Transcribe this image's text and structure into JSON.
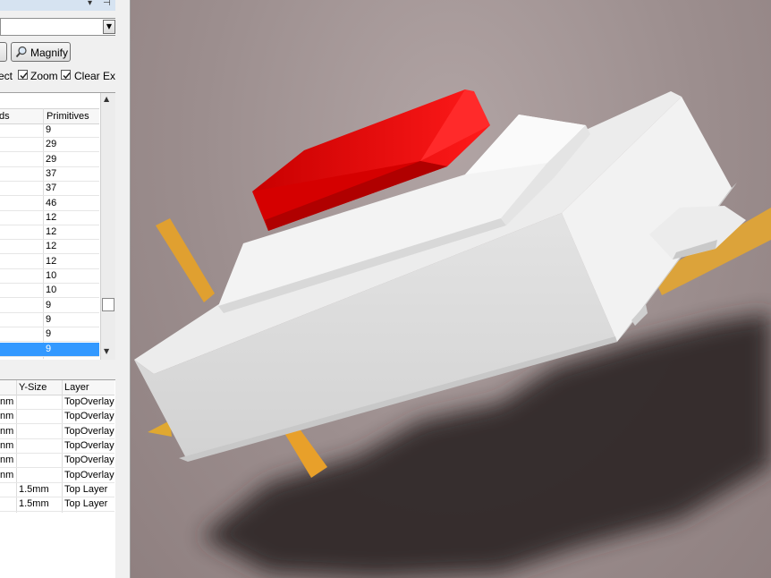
{
  "panel": {
    "header_icons": [
      "chevron-down-icon",
      "pin-icon",
      "close-icon"
    ],
    "combo_value": "",
    "magnify_label": "Magnify",
    "options": {
      "select_label": "ect",
      "zoom_label": "Zoom",
      "zoom_checked": true,
      "clear_label": "Clear Existin",
      "clear_checked": true
    }
  },
  "grid1": {
    "columns": [
      "ds",
      "Primitives"
    ],
    "rows": [
      "9",
      "29",
      "29",
      "37",
      "37",
      "46",
      "12",
      "12",
      "12",
      "12",
      "10",
      "10",
      "9",
      "9",
      "9",
      "9"
    ],
    "selected_index": 15
  },
  "grid2": {
    "columns": [
      "",
      "Y-Size",
      "Layer"
    ],
    "rows": [
      {
        "x": "nm",
        "y": "",
        "layer": "TopOverlay"
      },
      {
        "x": "nm",
        "y": "",
        "layer": "TopOverlay"
      },
      {
        "x": "nm",
        "y": "",
        "layer": "TopOverlay"
      },
      {
        "x": "nm",
        "y": "",
        "layer": "TopOverlay"
      },
      {
        "x": "nm",
        "y": "",
        "layer": "TopOverlay"
      },
      {
        "x": "nm",
        "y": "",
        "layer": "TopOverlay"
      },
      {
        "x": "",
        "y": "1.5mm",
        "layer": "Top Layer"
      },
      {
        "x": "",
        "y": "1.5mm",
        "layer": "Top Layer"
      }
    ]
  },
  "viewport": {
    "component_body_color": "#e6e6e6",
    "button_color": "#e10000",
    "pin_color": "#e2a02a",
    "shadow_color": "#2e2626"
  }
}
